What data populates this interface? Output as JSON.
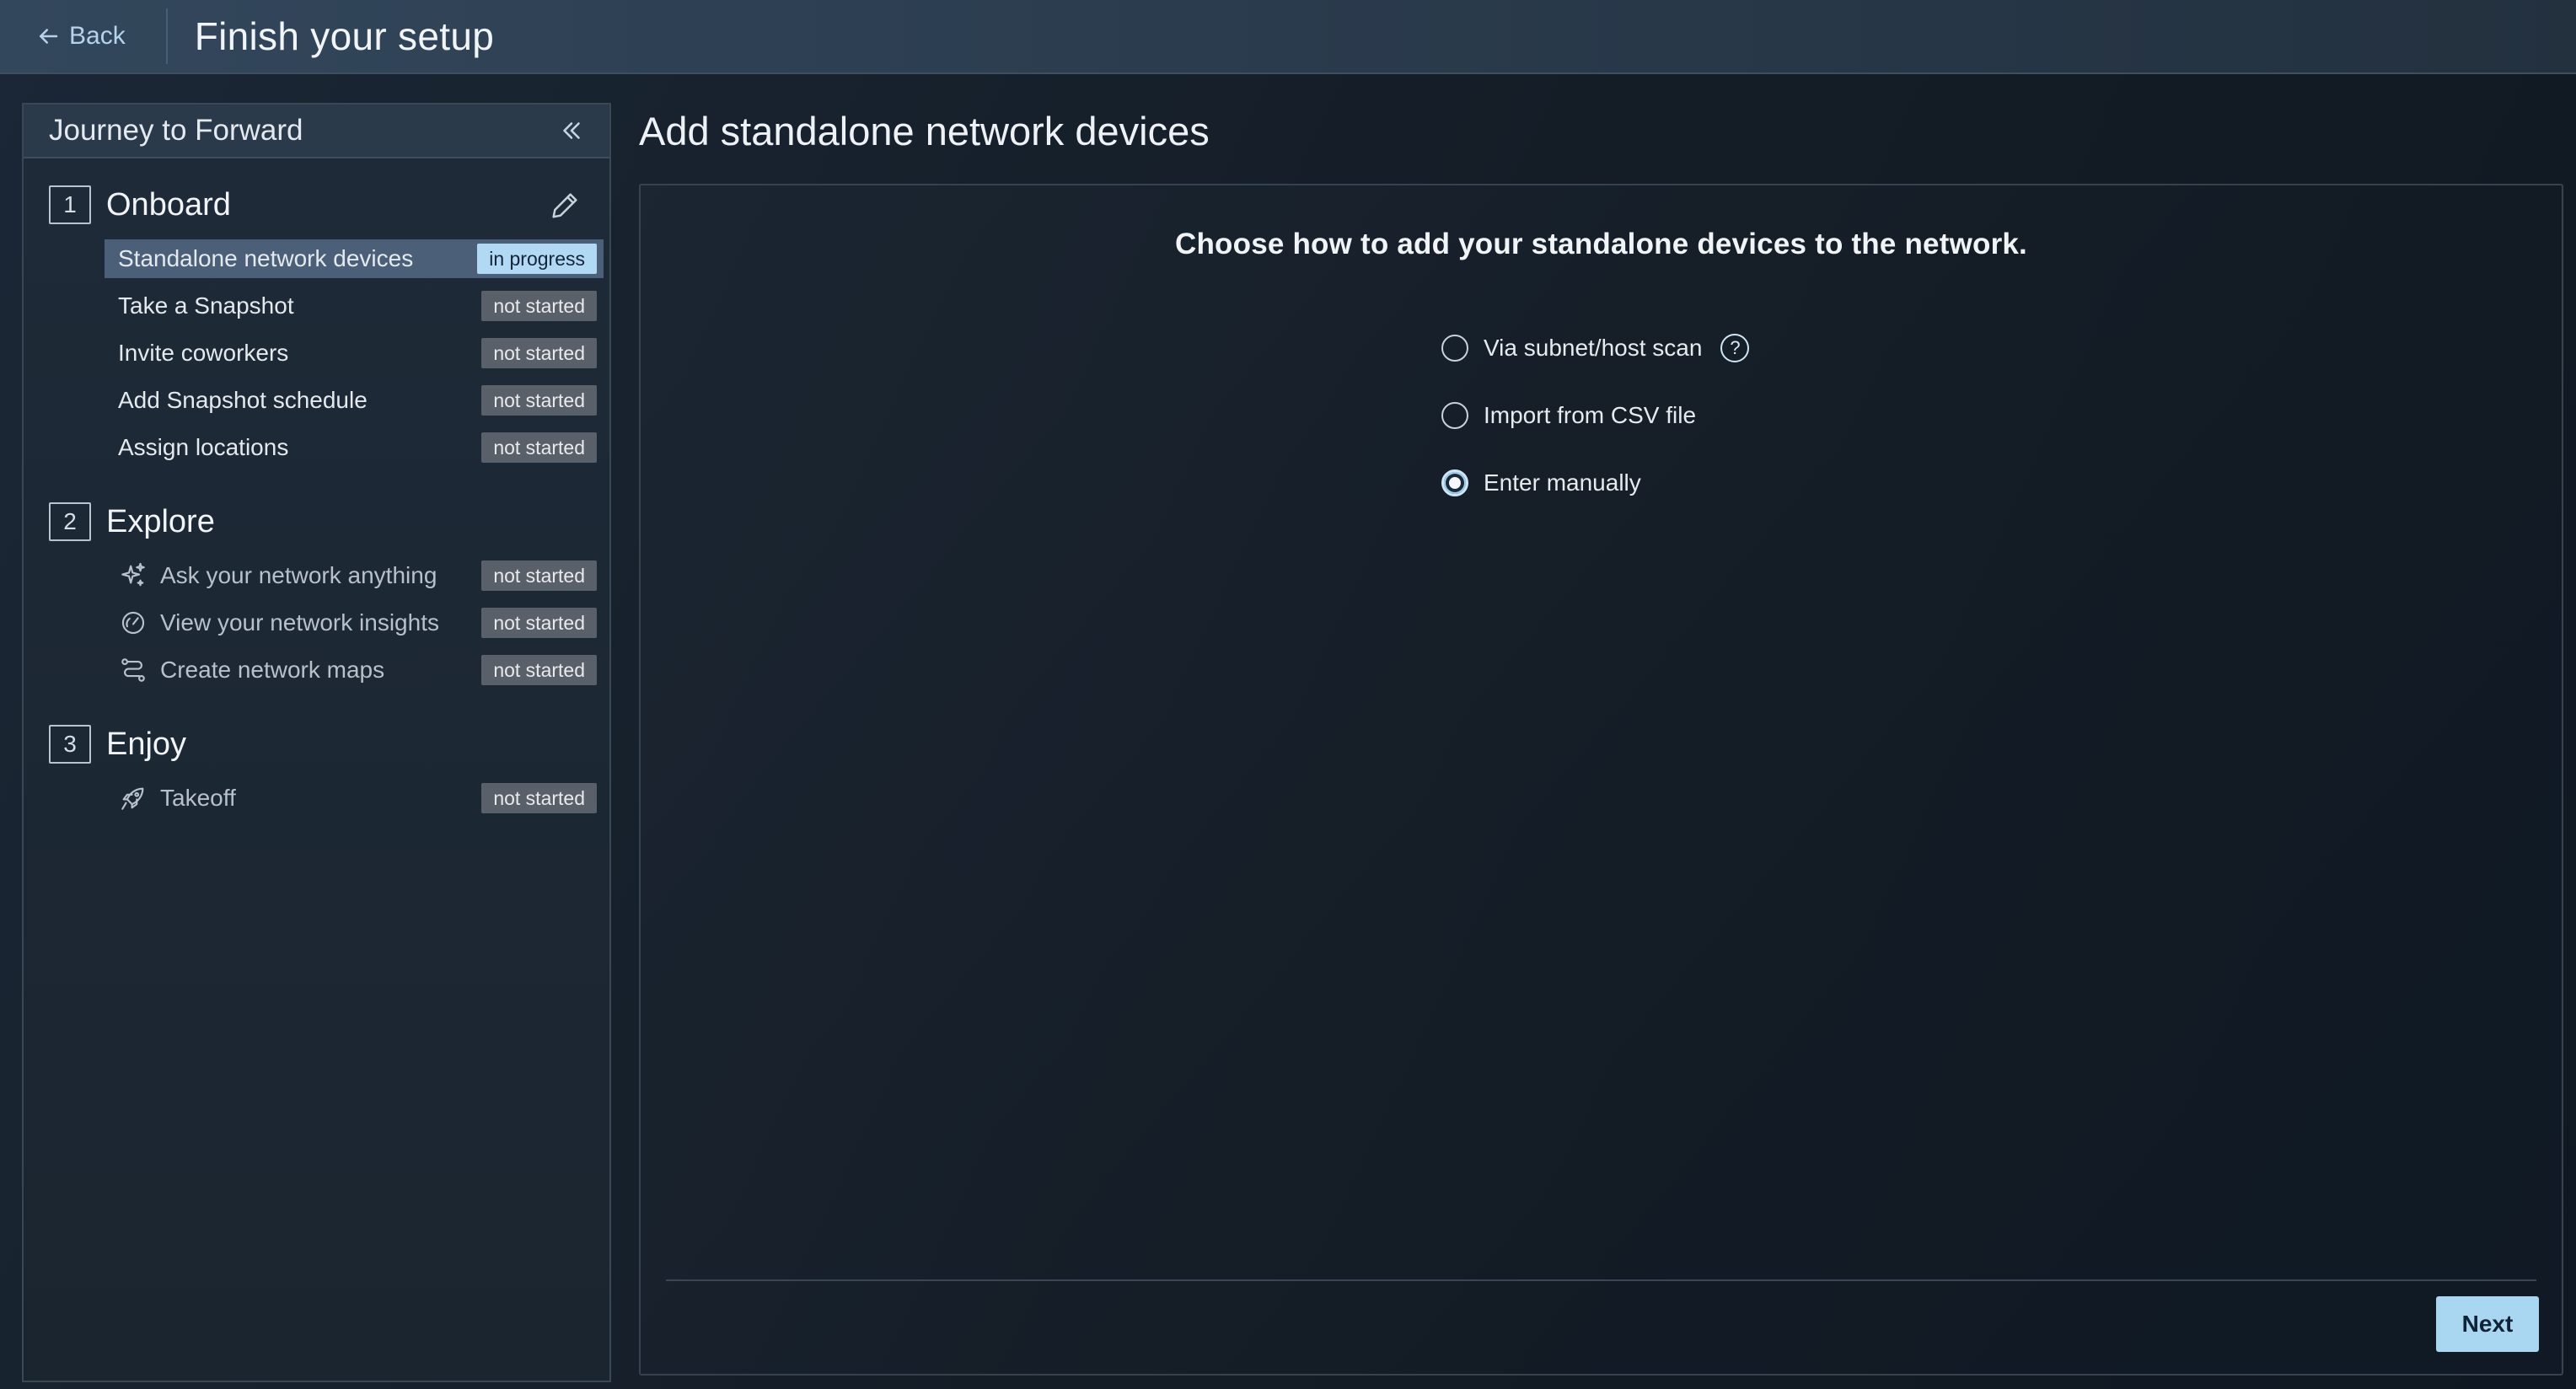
{
  "header": {
    "back_label": "Back",
    "title": "Finish your setup"
  },
  "sidebar": {
    "title": "Journey to Forward",
    "steps": [
      {
        "number": "1",
        "label": "Onboard",
        "items": [
          {
            "label": "Standalone network devices",
            "status": "in progress",
            "icon": ""
          },
          {
            "label": "Take a Snapshot",
            "status": "not started",
            "icon": ""
          },
          {
            "label": "Invite coworkers",
            "status": "not started",
            "icon": ""
          },
          {
            "label": "Add Snapshot schedule",
            "status": "not started",
            "icon": ""
          },
          {
            "label": "Assign locations",
            "status": "not started",
            "icon": ""
          }
        ]
      },
      {
        "number": "2",
        "label": "Explore",
        "items": [
          {
            "label": "Ask your network anything",
            "status": "not started",
            "icon": "sparkle-icon"
          },
          {
            "label": "View your network insights",
            "status": "not started",
            "icon": "gauge-icon"
          },
          {
            "label": "Create network maps",
            "status": "not started",
            "icon": "route-icon"
          }
        ]
      },
      {
        "number": "3",
        "label": "Enjoy",
        "items": [
          {
            "label": "Takeoff",
            "status": "not started",
            "icon": "rocket-icon"
          }
        ]
      }
    ]
  },
  "main": {
    "title": "Add standalone network devices",
    "prompt": "Choose how to add your standalone devices to the network.",
    "options": [
      {
        "label": "Via subnet/host scan",
        "selected": false,
        "help": "?"
      },
      {
        "label": "Import from CSV file",
        "selected": false
      },
      {
        "label": "Enter manually",
        "selected": true
      }
    ],
    "next_label": "Next"
  },
  "colors": {
    "badge_in_progress": "#b2d9f3",
    "badge_not_started": "#5a6069",
    "next_button": "#a9d6f1",
    "active_item": "#4b6078"
  }
}
